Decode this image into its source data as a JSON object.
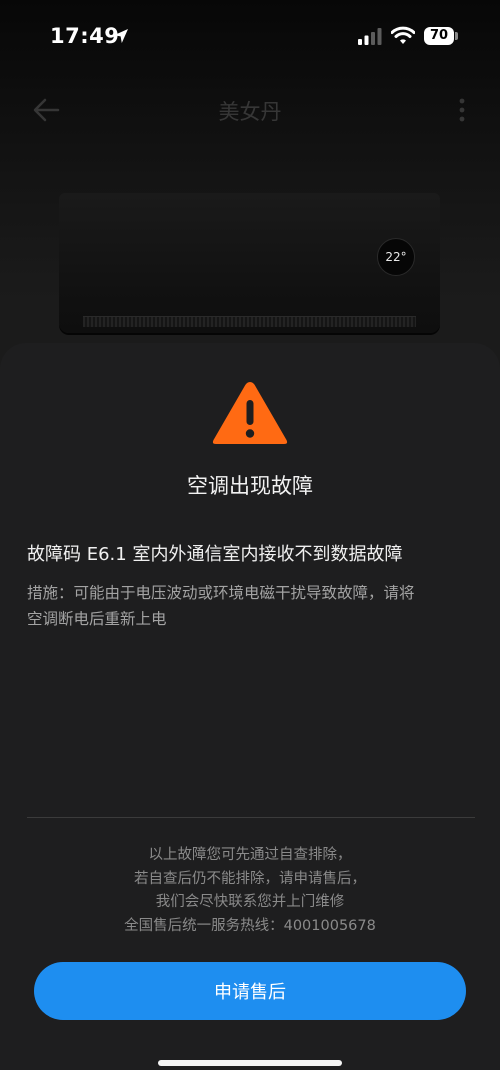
{
  "status_bar": {
    "time": "17:49",
    "battery": "70"
  },
  "header": {
    "title": "美女丹"
  },
  "device": {
    "display_temp": "22°"
  },
  "fault_sheet": {
    "title": "空调出现故障",
    "fault_code_text": "故障码 E6.1 室内外通信室内接收不到数据故障",
    "measure_line1": "措施：可能由于电压波动或环境电磁干扰导致故障，请将",
    "measure_line2": "空调断电后重新上电",
    "notice_lines": [
      "以上故障您可先通过自查排除，",
      "若自查后仍不能排除，请申请售后，",
      "我们会尽快联系您并上门维修",
      "全国售后统一服务热线：4001005678"
    ],
    "apply_button_label": "申请售后"
  },
  "colors": {
    "accent": "#1e8ef0",
    "warning": "#ff6a13",
    "sheet_background": "#1e1e1f"
  },
  "icons": {
    "warning": "warning-triangle-icon",
    "back": "back-arrow-icon",
    "more": "more-vertical-icon"
  }
}
